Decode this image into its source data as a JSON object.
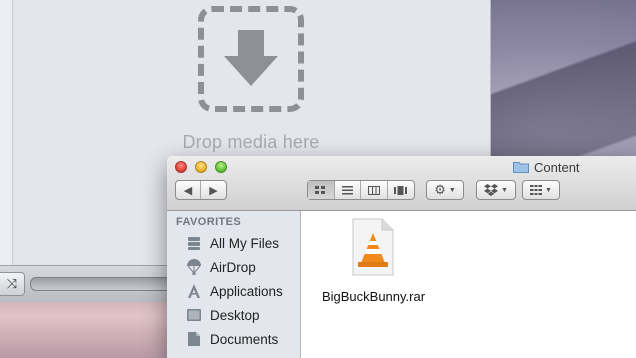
{
  "vlc": {
    "drop_label": "Drop media here",
    "shuffle_icon": "shuffle-icon"
  },
  "finder": {
    "window_title": "Content",
    "nav": {
      "back_icon": "back-arrow-icon",
      "forward_icon": "forward-arrow-icon"
    },
    "view_modes": [
      "icon-view",
      "list-view",
      "column-view",
      "cover-flow-view"
    ],
    "active_view": "icon-view",
    "toolbar": {
      "action_icon": "gear-icon",
      "dropbox_icon": "dropbox-icon",
      "arrange_icon": "arrange-icon"
    },
    "sidebar": {
      "section_title": "FAVORITES",
      "items": [
        {
          "label": "All My Files",
          "icon": "all-files-icon"
        },
        {
          "label": "AirDrop",
          "icon": "airdrop-icon"
        },
        {
          "label": "Applications",
          "icon": "applications-icon"
        },
        {
          "label": "Desktop",
          "icon": "desktop-icon"
        },
        {
          "label": "Documents",
          "icon": "documents-icon"
        }
      ]
    },
    "files": [
      {
        "name": "BigBuckBunny.rar",
        "icon": "vlc-file-icon"
      }
    ]
  },
  "colors": {
    "drop_zone": "#8e9096",
    "drop_label": "#a9abb1",
    "sidebar_bg": "#e3e7ed",
    "sidebar_header": "#6f7782",
    "vlc_orange": "#f18a1d"
  }
}
